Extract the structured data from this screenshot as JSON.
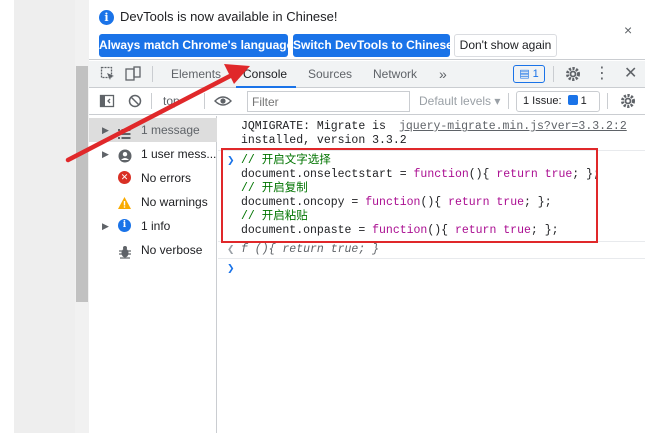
{
  "infobar": {
    "message": "DevTools is now available in Chinese!",
    "btn_match": "Always match Chrome's language",
    "btn_switch": "Switch DevTools to Chinese",
    "btn_dismiss": "Don't show again",
    "close": "×"
  },
  "tabs": {
    "elements": "Elements",
    "console": "Console",
    "sources": "Sources",
    "network": "Network",
    "more": "»",
    "messages_count": "1"
  },
  "toolbar": {
    "context": "top",
    "filter_placeholder": "Filter",
    "levels": "Default levels ▾",
    "issues_label": "1 Issue:",
    "issues_count": "1"
  },
  "sidebar": {
    "items": [
      {
        "label": "1 message",
        "icon": "list-icon"
      },
      {
        "label": "1 user mess...",
        "icon": "user-icon"
      },
      {
        "label": "No errors",
        "icon": "error-icon"
      },
      {
        "label": "No warnings",
        "icon": "warning-icon"
      },
      {
        "label": "1 info",
        "icon": "info-icon"
      },
      {
        "label": "No verbose",
        "icon": "bug-icon"
      }
    ]
  },
  "console": {
    "migrate_text_1": "JQMIGRATE: Migrate is",
    "migrate_link": "jquery-migrate.min.js?ver=3.3.2:2",
    "migrate_text_2": "installed, version 3.3.2",
    "c1": "// 开启文字选择",
    "l1_obj": "document.onselectstart = ",
    "c2": "// 开启复制",
    "l2_obj": "document.oncopy = ",
    "c3": "// 开启粘贴",
    "l3_obj": "document.onpaste = ",
    "fn_kw": "function",
    "fn_parens": "(){ ",
    "ret_kw": "return",
    "true_kw": "true",
    "fn_end": "; };",
    "result": "f (){ return true; }"
  },
  "colors": {
    "accent": "#1a73e8",
    "annotation_red": "#e0282a",
    "keyword": "#aa0d91",
    "comment": "#007400"
  }
}
